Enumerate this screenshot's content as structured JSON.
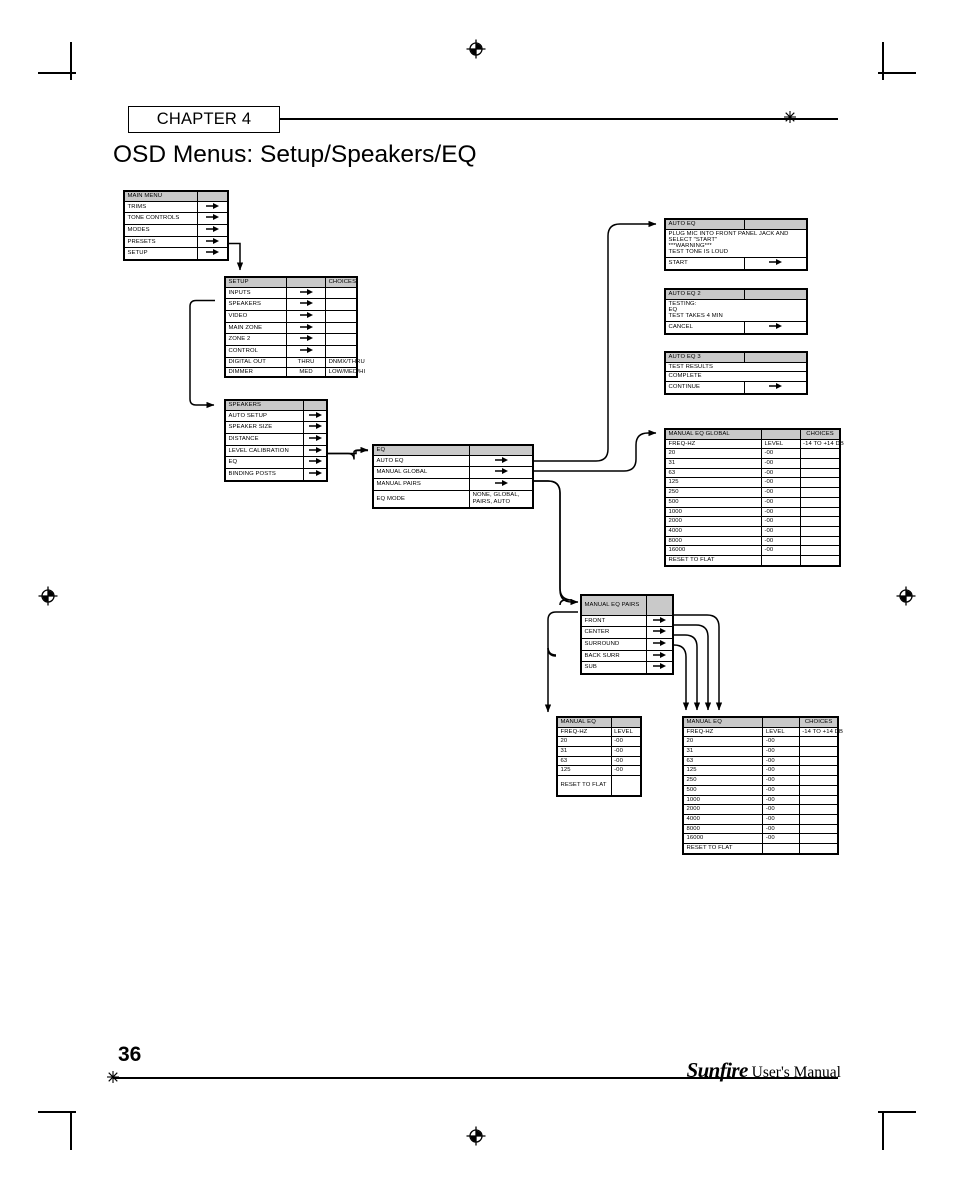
{
  "header": {
    "chapter_label": "CHAPTER 4",
    "title": "OSD Menus: Setup/Speakers/EQ"
  },
  "footer": {
    "page_number": "36",
    "brand": "Sunfire",
    "brand_suffix": "User's Manual"
  },
  "diagram": {
    "main_menu": {
      "title": "MAIN MENU",
      "rows": [
        "TRIMS",
        "TONE CONTROLS",
        "MODES",
        "PRESETS",
        "SETUP"
      ]
    },
    "setup": {
      "title": "SETUP",
      "choices_header": "CHOICES",
      "rows": [
        {
          "label": "INPUTS",
          "value": "",
          "choices": ""
        },
        {
          "label": "SPEAKERS",
          "value": "",
          "choices": ""
        },
        {
          "label": "VIDEO",
          "value": "",
          "choices": ""
        },
        {
          "label": "MAIN ZONE",
          "value": "",
          "choices": ""
        },
        {
          "label": "ZONE 2",
          "value": "",
          "choices": ""
        },
        {
          "label": "CONTROL",
          "value": "",
          "choices": ""
        },
        {
          "label": "DIGITAL OUT",
          "value": "THRU",
          "choices": "DNMX/THRU"
        },
        {
          "label": "DIMMER",
          "value": "MED",
          "choices": "LOW/MED/HI"
        }
      ]
    },
    "speakers": {
      "title": "SPEAKERS",
      "rows": [
        "AUTO SETUP",
        "SPEAKER SIZE",
        "DISTANCE",
        "LEVEL CALIBRATION",
        "EQ",
        "BINDING POSTS"
      ]
    },
    "eq": {
      "title": "EQ",
      "rows": [
        {
          "label": "AUTO EQ",
          "value": ""
        },
        {
          "label": "MANUAL GLOBAL",
          "value": ""
        },
        {
          "label": "MANUAL PAIRS",
          "value": ""
        },
        {
          "label": "EQ MODE",
          "value": "NONE, GLOBAL, PAIRS, AUTO"
        }
      ]
    },
    "auto_eq": {
      "title": "AUTO EQ",
      "lines": [
        "PLUG MIC INTO FRONT PANEL JACK AND",
        "SELECT \"START\"",
        "***WARNING***",
        "TEST TONE IS LOUD"
      ],
      "action": "START"
    },
    "auto_eq_2": {
      "title": "AUTO EQ 2",
      "lines": [
        "TESTING:",
        "EQ",
        "TEST TAKES 4 MIN"
      ],
      "action": "CANCEL"
    },
    "auto_eq_3": {
      "title": "AUTO EQ 3",
      "lines": [
        "TEST RESULTS",
        "COMPLETE"
      ],
      "action": "CONTINUE"
    },
    "manual_eq_global": {
      "title": "MANUAL EQ GLOBAL",
      "choices_header": "CHOICES",
      "col_freq": "FREQ-HZ",
      "col_level": "LEVEL",
      "choices_value": "-14 TO +14 DB",
      "rows": [
        {
          "freq": "20",
          "level": "-00"
        },
        {
          "freq": "31",
          "level": "-00"
        },
        {
          "freq": "63",
          "level": "-00"
        },
        {
          "freq": "125",
          "level": "-00"
        },
        {
          "freq": "250",
          "level": "-00"
        },
        {
          "freq": "500",
          "level": "-00"
        },
        {
          "freq": "1000",
          "level": "-00"
        },
        {
          "freq": "2000",
          "level": "-00"
        },
        {
          "freq": "4000",
          "level": "-00"
        },
        {
          "freq": "8000",
          "level": "-00"
        },
        {
          "freq": "16000",
          "level": "-00"
        }
      ],
      "reset": "RESET TO FLAT"
    },
    "manual_eq_pairs": {
      "title": "MANUAL EQ PAIRS",
      "rows": [
        "FRONT",
        "CENTER",
        "SURROUND",
        "BACK SURR",
        "SUB"
      ]
    },
    "manual_eq_sub": {
      "title": "MANUAL EQ",
      "col_freq": "FREQ-HZ",
      "col_level": "LEVEL",
      "rows": [
        {
          "freq": "20",
          "level": "-00"
        },
        {
          "freq": "31",
          "level": "-00"
        },
        {
          "freq": "63",
          "level": "-00"
        },
        {
          "freq": "125",
          "level": "-00"
        }
      ],
      "reset": "RESET TO FLAT"
    },
    "manual_eq_pair": {
      "title": "MANUAL EQ",
      "choices_header": "CHOICES",
      "col_freq": "FREQ-HZ",
      "col_level": "LEVEL",
      "choices_value": "-14 TO +14 DB",
      "rows": [
        {
          "freq": "20",
          "level": "-00"
        },
        {
          "freq": "31",
          "level": "-00"
        },
        {
          "freq": "63",
          "level": "-00"
        },
        {
          "freq": "125",
          "level": "-00"
        },
        {
          "freq": "250",
          "level": "-00"
        },
        {
          "freq": "500",
          "level": "-00"
        },
        {
          "freq": "1000",
          "level": "-00"
        },
        {
          "freq": "2000",
          "level": "-00"
        },
        {
          "freq": "4000",
          "level": "-00"
        },
        {
          "freq": "8000",
          "level": "-00"
        },
        {
          "freq": "16000",
          "level": "-00"
        }
      ],
      "reset": "RESET TO FLAT"
    }
  },
  "colors": {
    "header_fill": "#c9c9c9",
    "line": "#000000",
    "page_bg": "#ffffff"
  }
}
